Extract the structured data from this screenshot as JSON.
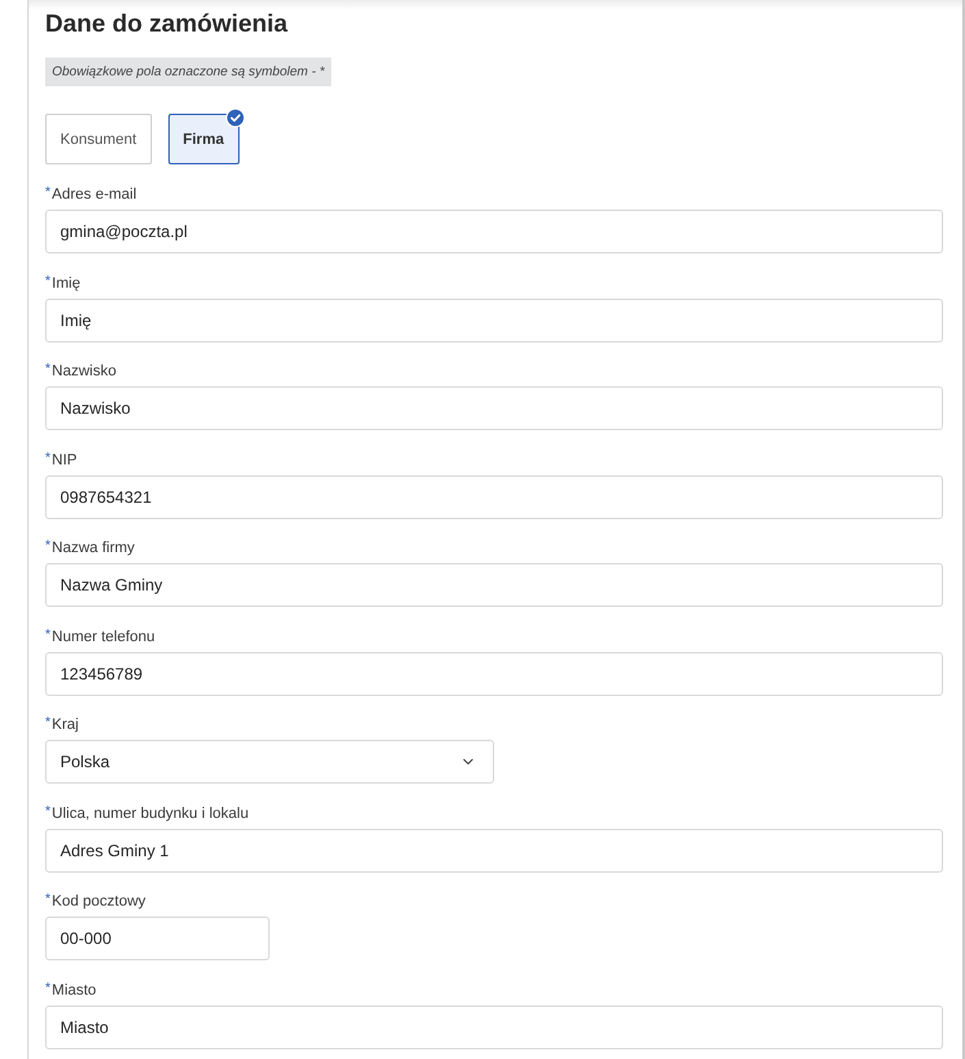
{
  "form": {
    "title": "Dane do zamówienia",
    "notice": "Obowiązkowe pola oznaczone są symbolem - *",
    "customer_type": [
      {
        "label": "Konsument",
        "selected": false
      },
      {
        "label": "Firma",
        "selected": true
      }
    ],
    "fields": [
      {
        "label": "Adres e-mail",
        "required_mark": "*",
        "kind": "text",
        "value": "gmina@poczta.pl"
      },
      {
        "label": "Imię",
        "required_mark": "*",
        "kind": "text",
        "value": "Imię"
      },
      {
        "label": "Nazwisko",
        "required_mark": "*",
        "kind": "text",
        "value": "Nazwisko"
      },
      {
        "label": "NIP",
        "required_mark": "*",
        "kind": "text",
        "value": "0987654321"
      },
      {
        "label": "Nazwa firmy",
        "required_mark": "*",
        "kind": "text",
        "value": "Nazwa Gminy"
      },
      {
        "label": "Numer telefonu",
        "required_mark": "*",
        "kind": "text",
        "value": "123456789"
      },
      {
        "label": "Kraj",
        "required_mark": "*",
        "kind": "select",
        "value": "Polska"
      },
      {
        "label": "Ulica, numer budynku i lokalu",
        "required_mark": "*",
        "kind": "text",
        "value": "Adres Gminy 1"
      },
      {
        "label": "Kod pocztowy",
        "required_mark": "*",
        "kind": "short",
        "value": "00-000"
      },
      {
        "label": "Miasto",
        "required_mark": "*",
        "kind": "text",
        "value": "Miasto"
      }
    ]
  }
}
